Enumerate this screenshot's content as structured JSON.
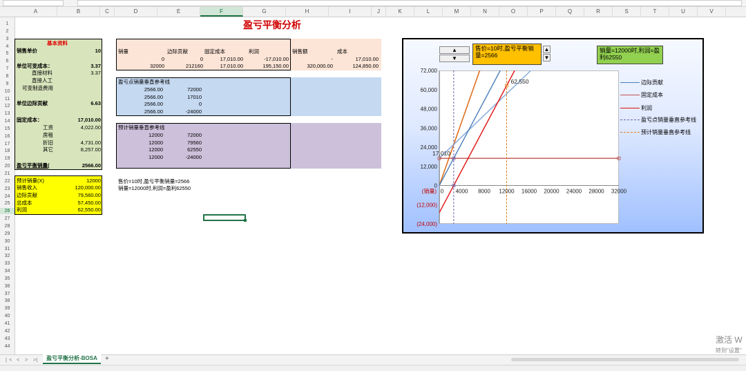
{
  "sheet": {
    "title": "盈亏平衡分析",
    "tab_name": "盈亏平衡分析-BOSA",
    "add_tab": "+",
    "tab_nav": [
      "|<",
      "<",
      ">",
      ">|"
    ],
    "columns": [
      "A",
      "B",
      "C",
      "D",
      "E",
      "F",
      "G",
      "H",
      "I",
      "J",
      "K",
      "L",
      "M",
      "N",
      "O",
      "P",
      "Q",
      "R",
      "S",
      "T",
      "U",
      "V"
    ],
    "selected_column": "F",
    "rows": [
      "1",
      "2",
      "3",
      "4",
      "5",
      "6",
      "7",
      "8",
      "9",
      "10",
      "11",
      "12",
      "13",
      "14",
      "15",
      "16",
      "17",
      "18",
      "19",
      "20",
      "21",
      "22",
      "23",
      "24",
      "25",
      "26",
      "27",
      "28",
      "29",
      "30",
      "31",
      "32",
      "33",
      "34",
      "35",
      "36",
      "37",
      "38",
      "39",
      "40",
      "41",
      "42",
      "43",
      "44"
    ],
    "selected_row": "26"
  },
  "basic": {
    "header": "基本资料",
    "price_label": "销售单价",
    "price": "10",
    "unit_var_label": "单位可变成本：",
    "unit_var": "3.37",
    "direct_mat_label": "直接材料",
    "direct_mat": "3.37",
    "direct_labor_label": "直接人工",
    "var_mfg_label": "可变制造费用",
    "unit_margin_label": "单位边际贡献",
    "unit_margin": "6.63",
    "fixed_label": "固定成本：",
    "fixed": "17,010.00",
    "wage_label": "工资",
    "wage": "4,022.00",
    "rent_label": "房租",
    "depr_label": "折旧",
    "depr": "4,731.00",
    "other_label": "其它",
    "other": "8,257.00",
    "bep_label": "盈亏平衡销量(",
    "bep": "2566.00"
  },
  "forecast": {
    "qty_label": "预计销量(X)",
    "qty": "12000",
    "rev_label": "销售收入",
    "rev": "120,000.00",
    "margin_label": "边际贡献",
    "margin": "79,560.00",
    "cost_label": "总成本",
    "cost": "57,450.00",
    "profit_label": "利润",
    "profit": "62,550.00"
  },
  "sales_table": {
    "headers": [
      "销量",
      "边际贡献",
      "固定成本",
      "利润",
      "销售额",
      "成本"
    ],
    "row1": [
      "0",
      "0",
      "17,010.00",
      "-17,010.00",
      "-",
      "17,010.00"
    ],
    "row2": [
      "32000",
      "212160",
      "17,010.00",
      "195,150.00",
      "320,000.00",
      "124,850.00"
    ]
  },
  "bep_ref": {
    "title": "盈亏点销量垂直参考线",
    "rows": [
      [
        "2566.00",
        "72000"
      ],
      [
        "2566.00",
        "17010"
      ],
      [
        "2566.00",
        "0"
      ],
      [
        "2566.00",
        "-24000"
      ]
    ]
  },
  "pred_ref": {
    "title": "预计销量垂直参考线",
    "rows": [
      [
        "12000",
        "72000"
      ],
      [
        "12000",
        "79560"
      ],
      [
        "12000",
        "62550"
      ],
      [
        "12000",
        "-24000"
      ]
    ]
  },
  "notes": {
    "line1": "售价=10时,盈亏平衡销量=2566",
    "line2": "销量=12000时,利润=盈利62550"
  },
  "chart_controls": {
    "price_info": "售价=10时,盈亏平衡销量=2566",
    "qty_info": "销量=12000时,利润=盈利62550",
    "spin_up": "▲",
    "spin_down": "▼"
  },
  "chart_data": {
    "type": "line",
    "xlabel": "(销量)",
    "x_ticks": [
      "0",
      "4000",
      "8000",
      "12000",
      "16000",
      "20000",
      "24000",
      "28000",
      "32000"
    ],
    "y_ticks": [
      "72,000",
      "60,000",
      "48,000",
      "36,000",
      "24,000",
      "12,000",
      "0",
      "(12,000)",
      "(24,000)"
    ],
    "xlim": [
      0,
      32000
    ],
    "ylim": [
      -24000,
      72000
    ],
    "annotations": [
      "17,010",
      "62,550"
    ],
    "series": [
      {
        "name": "边际贡献",
        "color": "#4a7ebb",
        "x": [
          0,
          32000
        ],
        "y": [
          0,
          212160
        ]
      },
      {
        "name": "固定成本",
        "color": "#c0504d",
        "x": [
          0,
          32000
        ],
        "y": [
          17010,
          17010
        ]
      },
      {
        "name": "利润",
        "color": "#e01010",
        "x": [
          0,
          32000
        ],
        "y": [
          -17010,
          195150
        ]
      },
      {
        "name": "盈亏点销量垂直参考线",
        "color": "#7060a8",
        "x": [
          2566,
          2566,
          2566,
          2566
        ],
        "y": [
          72000,
          17010,
          0,
          -24000
        ]
      },
      {
        "name": "预计销量垂直参考线",
        "color": "#e08020",
        "x": [
          12000,
          12000,
          12000,
          12000
        ],
        "y": [
          72000,
          79560,
          62550,
          -24000
        ]
      }
    ],
    "extra_lines": [
      {
        "color": "#e07020",
        "x": [
          0,
          32000
        ],
        "y": [
          0,
          320000
        ]
      },
      {
        "color": "#8fb0dd",
        "x": [
          0,
          32000
        ],
        "y": [
          17010,
          124850
        ]
      }
    ]
  },
  "colors": {
    "accent": "#217346"
  },
  "watermark": {
    "line1": "激活 W",
    "line2": "转到\"设置\""
  }
}
